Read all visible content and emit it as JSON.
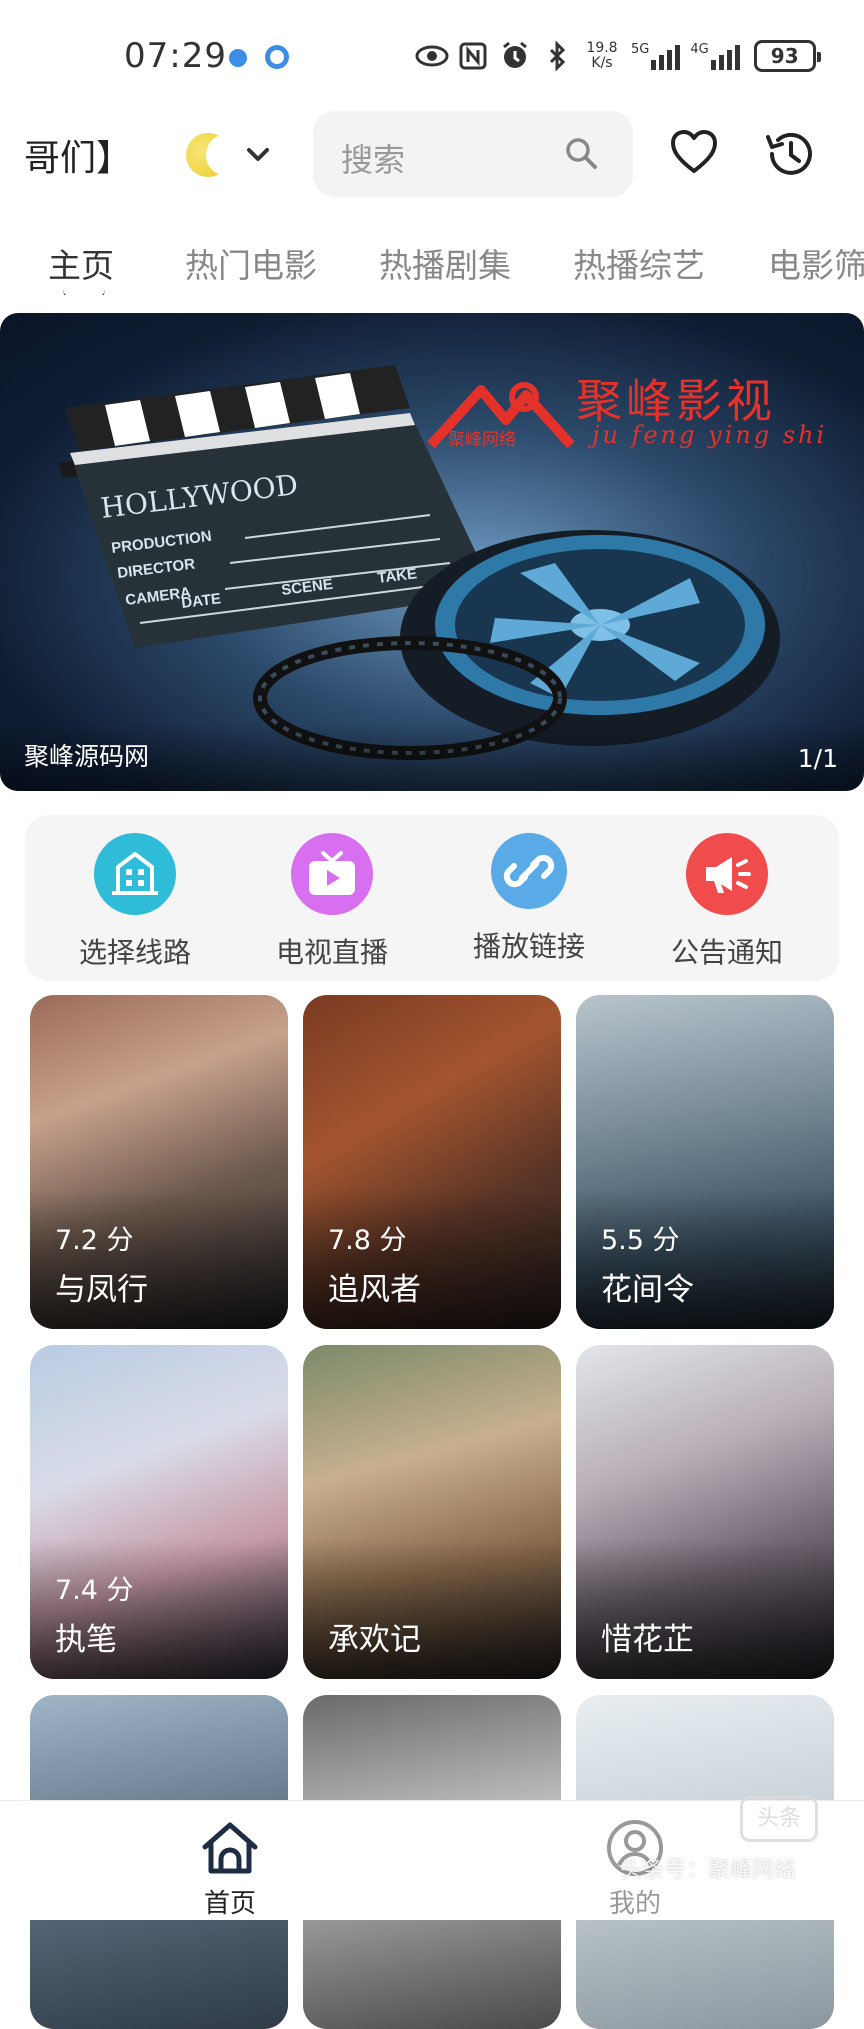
{
  "status_bar": {
    "time": "07:29",
    "net_speed_value": "19.8",
    "net_speed_unit": "K/s",
    "signal_1": "5G",
    "signal_2": "4G",
    "battery": "93"
  },
  "header": {
    "app_title": "哥们】",
    "search_placeholder": "搜索",
    "icons": [
      "moon-icon",
      "chevron-down-icon",
      "search-icon",
      "heart-icon",
      "history-icon"
    ]
  },
  "tabs": [
    {
      "label": "主页",
      "active": true
    },
    {
      "label": "热门电影",
      "active": false
    },
    {
      "label": "热播剧集",
      "active": false
    },
    {
      "label": "热播综艺",
      "active": false
    },
    {
      "label": "电影筛",
      "active": false
    }
  ],
  "banner": {
    "brand_cn": "聚峰影视",
    "brand_pinyin": "ju feng ying shi",
    "brand_small": "聚峰网络",
    "slate_title": "HOLLYWOOD",
    "slate_rows": [
      "PRODUCTION",
      "DIRECTOR",
      "CAMERA"
    ],
    "slate_cols": [
      "DATE",
      "SCENE",
      "TAKE"
    ],
    "caption": "聚峰源码网",
    "pager": "1/1"
  },
  "quick_actions": [
    {
      "label": "选择线路",
      "icon": "building-icon",
      "color": "#2fbcd8"
    },
    {
      "label": "电视直播",
      "icon": "tv-play-icon",
      "color": "#d86ff0"
    },
    {
      "label": "播放链接",
      "icon": "link-icon",
      "color": "#5aaae8"
    },
    {
      "label": "公告通知",
      "icon": "megaphone-icon",
      "color": "#f04c4c"
    }
  ],
  "movies": [
    {
      "title": "与凤行",
      "score": "7.2 分"
    },
    {
      "title": "追风者",
      "score": "7.8 分"
    },
    {
      "title": "花间令",
      "score": "5.5 分"
    },
    {
      "title": "执笔",
      "score": "7.4 分"
    },
    {
      "title": "承欢记",
      "score": ""
    },
    {
      "title": "惜花芷",
      "score": ""
    },
    {
      "title": "",
      "score": ""
    },
    {
      "title": "",
      "score": ""
    },
    {
      "title": "",
      "score": ""
    }
  ],
  "bottom_nav": [
    {
      "label": "首页",
      "icon": "home-icon",
      "active": true
    },
    {
      "label": "我的",
      "icon": "user-icon",
      "active": false
    }
  ],
  "watermark": {
    "text": "头条号：聚峰网络",
    "logo": "头条"
  }
}
